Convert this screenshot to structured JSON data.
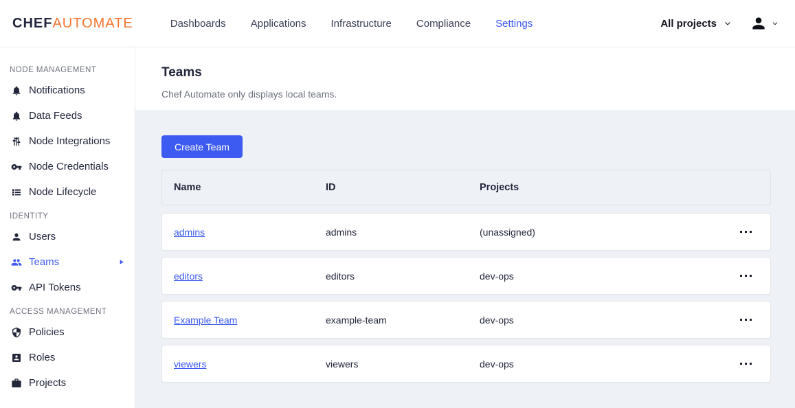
{
  "header": {
    "logo_chef": "CHEF",
    "logo_automate": "AUTOMATE",
    "nav": [
      {
        "label": "Dashboards",
        "active": false
      },
      {
        "label": "Applications",
        "active": false
      },
      {
        "label": "Infrastructure",
        "active": false
      },
      {
        "label": "Compliance",
        "active": false
      },
      {
        "label": "Settings",
        "active": true
      }
    ],
    "projects_filter": {
      "label": "All projects",
      "icon": "chevron-down-icon"
    },
    "user_menu": {
      "icon": "user-avatar-icon",
      "chevron": "chevron-down-icon"
    }
  },
  "sidebar": {
    "sections": [
      {
        "title": "NODE MANAGEMENT",
        "items": [
          {
            "label": "Notifications",
            "icon": "bell-icon",
            "active": false
          },
          {
            "label": "Data Feeds",
            "icon": "bell-icon",
            "active": false
          },
          {
            "label": "Node Integrations",
            "icon": "sliders-icon",
            "active": false
          },
          {
            "label": "Node Credentials",
            "icon": "key-icon",
            "active": false
          },
          {
            "label": "Node Lifecycle",
            "icon": "list-icon",
            "active": false
          }
        ]
      },
      {
        "title": "IDENTITY",
        "items": [
          {
            "label": "Users",
            "icon": "user-icon",
            "active": false
          },
          {
            "label": "Teams",
            "icon": "users-icon",
            "active": true
          },
          {
            "label": "API Tokens",
            "icon": "key-icon",
            "active": false
          }
        ]
      },
      {
        "title": "ACCESS MANAGEMENT",
        "items": [
          {
            "label": "Policies",
            "icon": "shield-icon",
            "active": false
          },
          {
            "label": "Roles",
            "icon": "badge-icon",
            "active": false
          },
          {
            "label": "Projects",
            "icon": "briefcase-icon",
            "active": false
          }
        ]
      }
    ]
  },
  "main": {
    "title": "Teams",
    "subtitle": "Chef Automate only displays local teams.",
    "create_button": "Create Team",
    "table": {
      "columns": [
        "Name",
        "ID",
        "Projects"
      ],
      "rows": [
        {
          "name": "admins",
          "id": "admins",
          "projects": "(unassigned)"
        },
        {
          "name": "editors",
          "id": "editors",
          "projects": "dev-ops"
        },
        {
          "name": "Example Team",
          "id": "example-team",
          "projects": "dev-ops"
        },
        {
          "name": "viewers",
          "id": "viewers",
          "projects": "dev-ops"
        }
      ]
    }
  },
  "colors": {
    "accent_blue": "#3d5af1",
    "brand_orange": "#f4732c",
    "page_background": "#eef1f5",
    "dark_text": "#23273c",
    "muted_text": "#6c7180"
  }
}
